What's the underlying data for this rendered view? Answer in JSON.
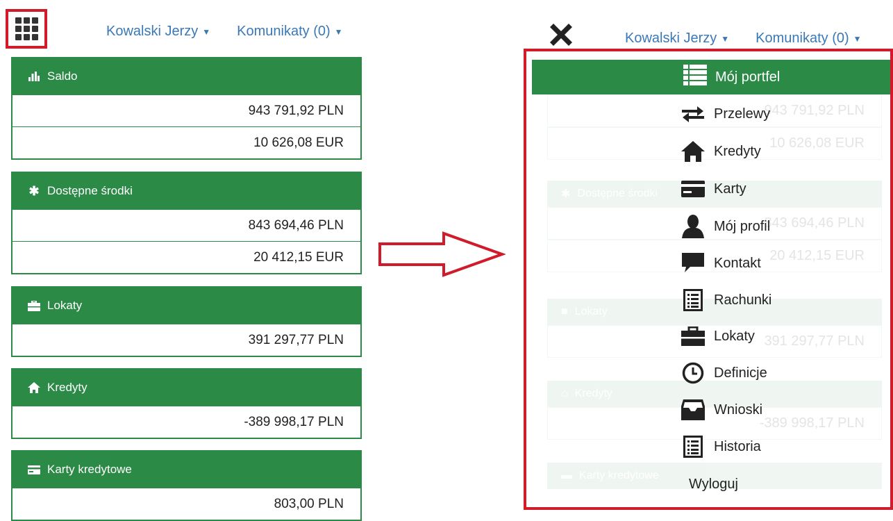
{
  "left": {
    "nav": {
      "user": "Kowalski Jerzy",
      "messages": "Komunikaty (0)"
    },
    "cards": [
      {
        "title": "Saldo",
        "icon": "bar-chart-icon",
        "rows": [
          "943 791,92 PLN",
          "10 626,08 EUR"
        ]
      },
      {
        "title": "Dostępne środki",
        "icon": "asterisk-icon",
        "rows": [
          "843 694,46 PLN",
          "20 412,15 EUR"
        ]
      },
      {
        "title": "Lokaty",
        "icon": "briefcase-icon",
        "rows": [
          "391 297,77 PLN"
        ]
      },
      {
        "title": "Kredyty",
        "icon": "home-icon",
        "rows": [
          "-389 998,17 PLN"
        ]
      },
      {
        "title": "Karty kredytowe",
        "icon": "credit-card-icon",
        "rows": [
          "803,00 PLN"
        ]
      }
    ]
  },
  "right": {
    "nav": {
      "user": "Kowalski Jerzy",
      "messages": "Komunikaty (0)"
    },
    "menu": {
      "header": "Mój portfel",
      "items": [
        {
          "label": "Przelewy",
          "icon": "transfer-arrows-icon"
        },
        {
          "label": "Kredyty",
          "icon": "home-icon"
        },
        {
          "label": "Karty",
          "icon": "credit-card-icon"
        },
        {
          "label": "Mój profil",
          "icon": "user-icon"
        },
        {
          "label": "Kontakt",
          "icon": "chat-bubble-icon"
        },
        {
          "label": "Rachunki",
          "icon": "document-list-icon"
        },
        {
          "label": "Lokaty",
          "icon": "briefcase-icon"
        },
        {
          "label": "Definicje",
          "icon": "clock-icon"
        },
        {
          "label": "Wnioski",
          "icon": "inbox-icon"
        },
        {
          "label": "Historia",
          "icon": "document-list-icon"
        }
      ],
      "logout": "Wyloguj"
    },
    "ghost": {
      "cards": [
        {
          "title": "",
          "rows": [
            "943 791,92 PLN",
            "10 626,08 EUR"
          ]
        },
        {
          "title": "Dostępne środki",
          "rows": [
            "843 694,46 PLN",
            "20 412,15 EUR"
          ]
        },
        {
          "title": "Lokaty",
          "rows": [
            "391 297,77 PLN"
          ]
        },
        {
          "title": "Kredyty",
          "rows": [
            "-389 998,17 PLN"
          ]
        },
        {
          "title": "Karty kredytowe",
          "rows": []
        }
      ]
    }
  },
  "colors": {
    "green": "#2c8a47",
    "highlight_red": "#d11a2a",
    "link_blue": "#3a78b6"
  }
}
